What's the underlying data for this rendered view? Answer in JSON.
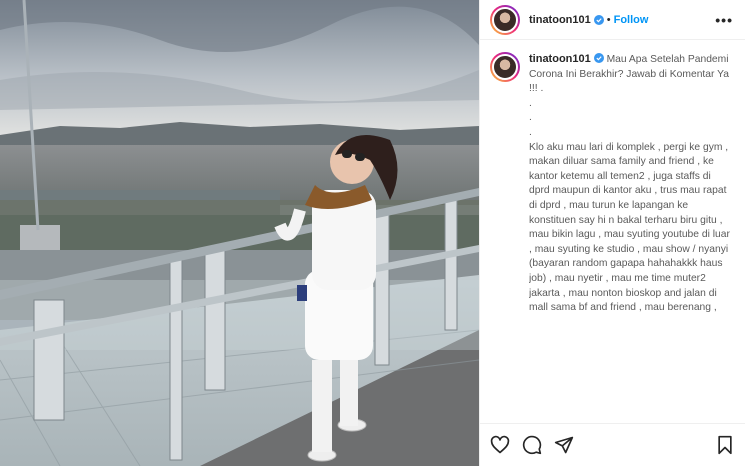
{
  "post": {
    "username": "tinatoon101",
    "follow_label": "Follow",
    "separator": "•",
    "more_label": "•••",
    "caption_text": " Mau Apa Setelah Pandemi Corona Ini Berakhir? Jawab di Komentar Ya !!! .\n.\n.\n.\nKlo aku mau lari di komplek , pergi ke gym , makan diluar sama family and friend , ke kantor ketemu all temen2 , juga staffs di dprd maupun di kantor aku , trus mau rapat di dprd , mau turun ke lapangan ke konstituen say hi n bakal terharu biru gitu , mau bikin lagu , mau syuting youtube di luar , mau syuting ke studio , mau show / nyanyi (bayaran random gapapa hahahakkk haus job) , mau nyetir , mau me time muter2 jakarta , mau nonton bioskop and jalan di mall sama bf and friend , mau berenang ,",
    "colors": {
      "follow": "#0095f6",
      "verified": "#3897f0"
    },
    "icons": [
      "heart-icon",
      "comment-icon",
      "share-icon",
      "bookmark-icon",
      "verified-badge-icon",
      "more-options-icon"
    ]
  }
}
